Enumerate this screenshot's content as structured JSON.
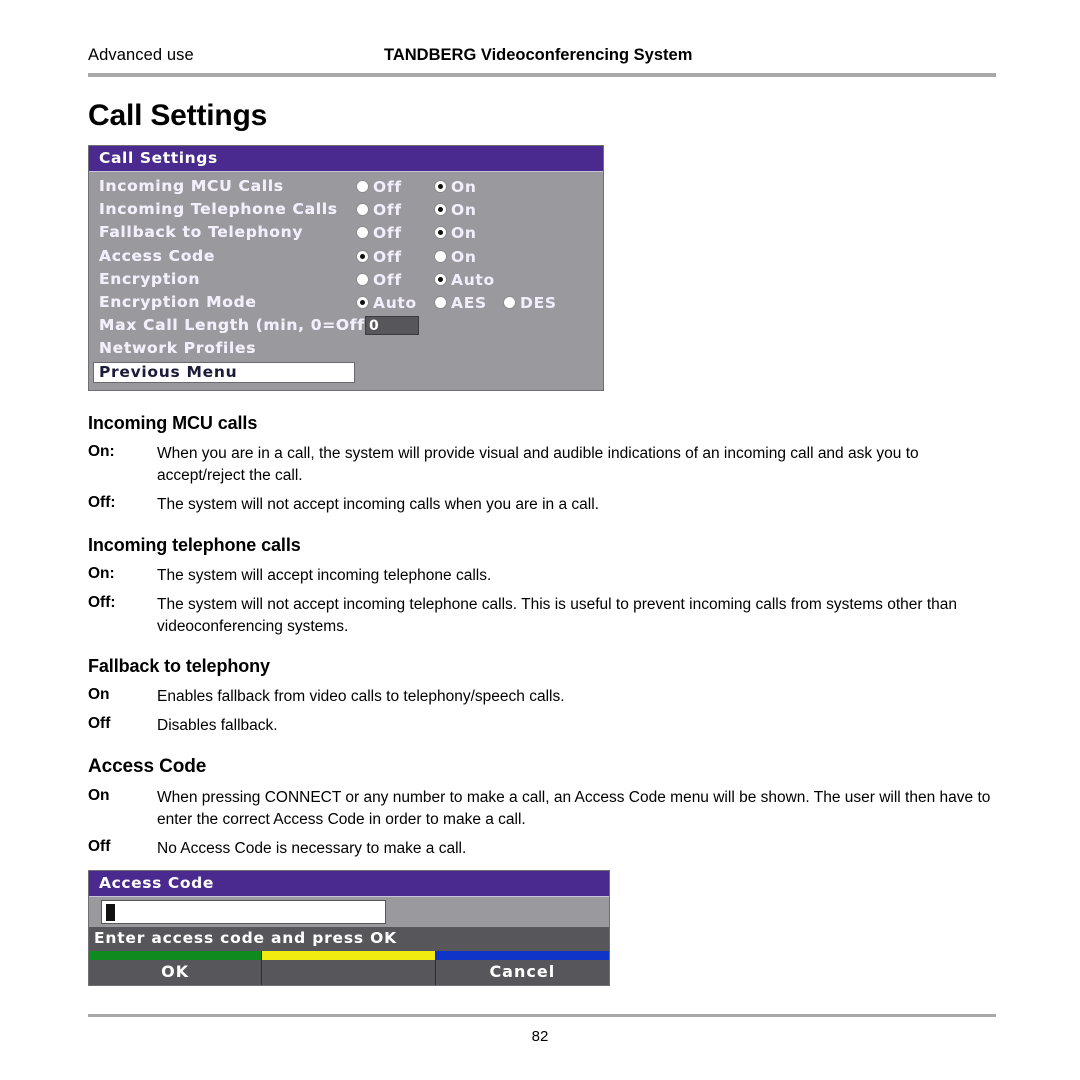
{
  "header": {
    "left": "Advanced use",
    "right": "TANDBERG Videoconferencing System"
  },
  "page_title": "Call Settings",
  "call_settings_menu": {
    "title": "Call Settings",
    "rows": [
      {
        "label": "Incoming MCU Calls",
        "options": [
          {
            "label": "Off",
            "selected": false
          },
          {
            "label": "On",
            "selected": true
          }
        ]
      },
      {
        "label": "Incoming Telephone Calls",
        "options": [
          {
            "label": "Off",
            "selected": false
          },
          {
            "label": "On",
            "selected": true
          }
        ]
      },
      {
        "label": "Fallback to Telephony",
        "options": [
          {
            "label": "Off",
            "selected": false
          },
          {
            "label": "On",
            "selected": true
          }
        ]
      },
      {
        "label": "Access Code",
        "options": [
          {
            "label": "Off",
            "selected": true
          },
          {
            "label": "On",
            "selected": false
          }
        ]
      },
      {
        "label": "Encryption",
        "options": [
          {
            "label": "Off",
            "selected": false
          },
          {
            "label": "Auto",
            "selected": true
          }
        ]
      },
      {
        "label": "Encryption Mode",
        "options": [
          {
            "label": "Auto",
            "selected": true
          },
          {
            "label": "AES",
            "selected": false
          },
          {
            "label": "DES",
            "selected": false
          }
        ]
      }
    ],
    "max_call_length": {
      "label": "Max Call Length (min, 0=Off)",
      "value": "0"
    },
    "network_profiles": "Network Profiles",
    "previous_menu": "Previous Menu"
  },
  "sections": [
    {
      "title": "Incoming MCU calls",
      "rows": [
        {
          "term": "On:",
          "desc": "When you are in a call, the system will provide visual and audible indications of an incoming call and ask you to accept/reject the call."
        },
        {
          "term": "Off:",
          "desc": "The system will not accept incoming calls when you are in a call."
        }
      ]
    },
    {
      "title": "Incoming telephone calls",
      "rows": [
        {
          "term": "On:",
          "desc": "The system will accept incoming telephone calls."
        },
        {
          "term": "Off:",
          "desc": "The system will not accept incoming telephone calls. This is useful to prevent incoming calls from systems other than videoconferencing systems."
        }
      ]
    },
    {
      "title": "Fallback to telephony",
      "rows": [
        {
          "term": "On",
          "desc": "Enables fallback from video calls to telephony/speech calls."
        },
        {
          "term": "Off",
          "desc": "Disables fallback."
        }
      ]
    },
    {
      "title": "Access Code",
      "rows": [
        {
          "term": "On",
          "desc": "When pressing CONNECT or any number to make a call, an Access Code menu will be shown. The user will then have to enter the correct Access Code in order to make a call."
        },
        {
          "term": "Off",
          "desc": "No Access Code is necessary to make a call."
        }
      ]
    }
  ],
  "access_code_dialog": {
    "title": "Access Code",
    "input_value": "",
    "prompt": "Enter access code and press OK",
    "buttons": [
      {
        "label": "OK",
        "color": "#0f8a1e"
      },
      {
        "label": "",
        "color": "#f2eb12"
      },
      {
        "label": "Cancel",
        "color": "#1034c8"
      }
    ]
  },
  "footer": {
    "page_number": "82"
  }
}
